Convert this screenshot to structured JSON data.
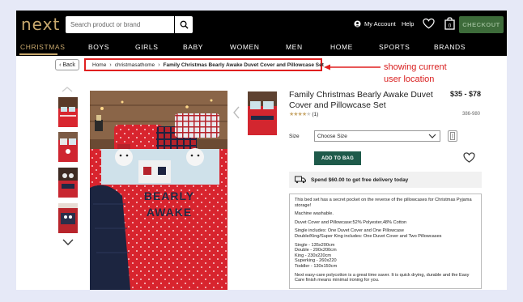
{
  "brand": {
    "logo": "next"
  },
  "search": {
    "placeholder": "Search product or brand"
  },
  "header": {
    "account_label": "My Account",
    "help_label": "Help",
    "checkout_label": "CHECKOUT"
  },
  "nav": {
    "items": [
      "CHRISTMAS",
      "BOYS",
      "GIRLS",
      "BABY",
      "WOMEN",
      "MEN",
      "HOME",
      "SPORTS",
      "BRANDS"
    ]
  },
  "breadcrumb": {
    "back_label": "Back",
    "home": "Home",
    "category": "christmasathome",
    "current": "Family Christmas Bearly Awake Duvet Cover and Pillowcase Set"
  },
  "annotation": {
    "line1": "showing current",
    "line2": "user location"
  },
  "main_image": {
    "text_line1": "BEARLY",
    "text_line2": "AWAKE"
  },
  "product": {
    "title": "Family Christmas Bearly Awake Duvet Cover and Pillowcase Set",
    "price": "$35 - $78",
    "rating": 4,
    "rating_count": "(1)",
    "code": "386-980",
    "size_label": "Size",
    "size_value": "Choose Size",
    "add_to_bag": "ADD TO BAG",
    "delivery": "Spend $60.00 to get free delivery today"
  },
  "description": [
    "This bed set has a secret pocket on the reverse of the pillowcases for Christmas Pyjama storage!",
    "Machine washable.",
    "Duvet Cover and Pillowcase:52% Polyester,48% Cotton",
    "Single includes: One Duvet Cover and One Pillowcase\nDouble/King/Super King includes: One Duvet Cover and Two Pillowcases",
    "Single - 135x200cm\nDouble - 200x200cm\nKing - 230x220cm\nSuperking - 260x220\nToddler - 130x150cm",
    "Next easy-care polycotton is a great time saver. It is quick drying, durable and the Easy Care finish means minimal ironing for you."
  ],
  "colors": {
    "accent_gold": "#c9a96e",
    "checkout_green": "#3d6b3a",
    "add_bag_green": "#1e5a4a",
    "annotation_red": "#e02020"
  }
}
